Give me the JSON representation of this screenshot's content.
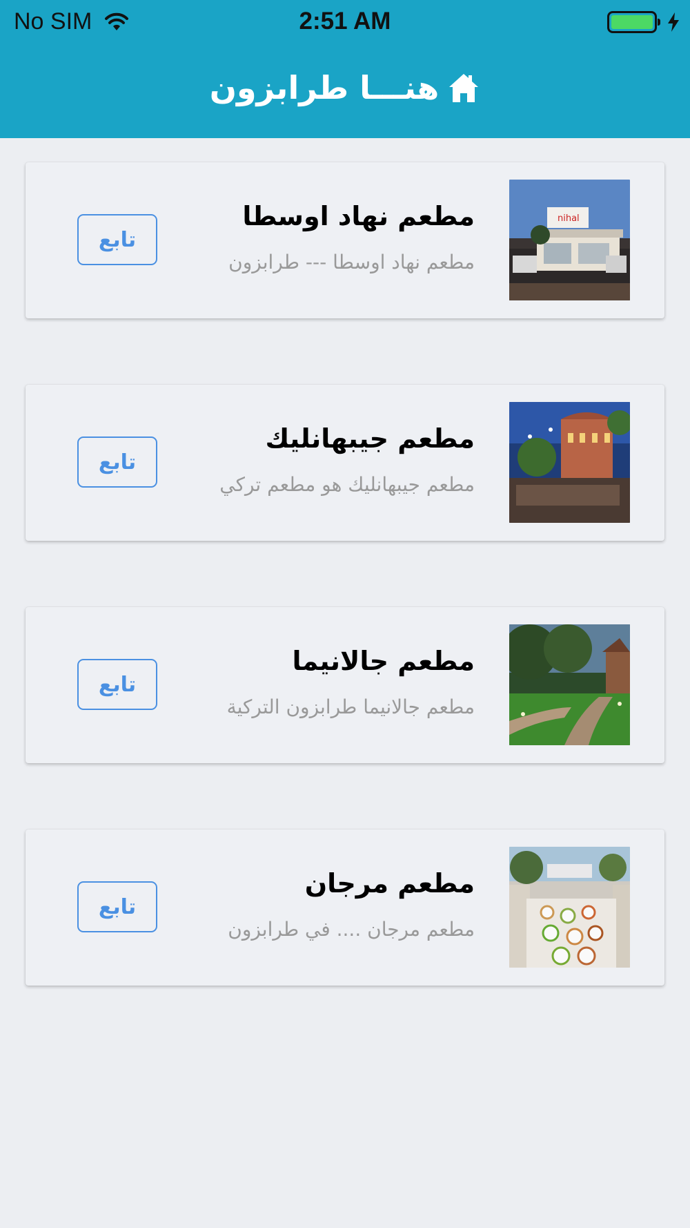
{
  "status_bar": {
    "carrier": "No SIM",
    "time": "2:51 AM"
  },
  "header": {
    "title": "هنـــا طرابزون",
    "icon": "home-icon"
  },
  "colors": {
    "header_bg": "#1aa4c6",
    "accent": "#4a90e2",
    "page_bg": "#eceef2"
  },
  "restaurants": [
    {
      "name": "مطعم نهاد اوسطا",
      "description": "مطعم نهاد اوسطا --- طرابزون",
      "follow_label": "تابع"
    },
    {
      "name": "مطعم جيبهانليك",
      "description": "مطعم جيبهانليك هو مطعم تركي",
      "follow_label": "تابع"
    },
    {
      "name": "مطعم جالانيما",
      "description": "مطعم جالانيما طرابزون التركية",
      "follow_label": "تابع"
    },
    {
      "name": "مطعم مرجان",
      "description": "مطعم مرجان .... في طرابزون",
      "follow_label": "تابع"
    }
  ]
}
